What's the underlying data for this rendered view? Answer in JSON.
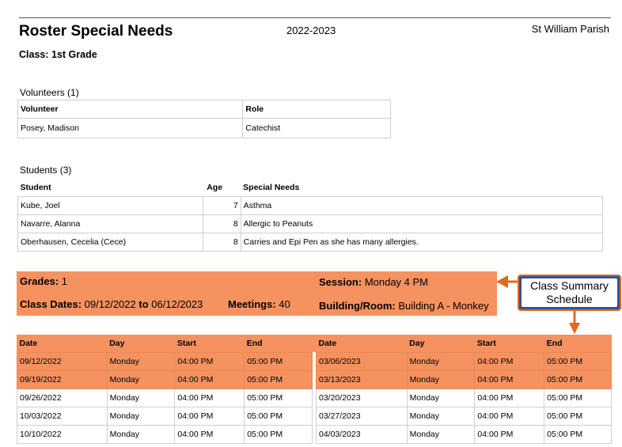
{
  "header": {
    "title": "Roster Special Needs",
    "year": "2022-2023",
    "parish": "St William Parish",
    "class_label": "Class: 1st Grade"
  },
  "volunteers": {
    "heading": "Volunteers (1)",
    "columns": [
      "Volunteer",
      "Role"
    ],
    "rows": [
      [
        "Posey, Madison",
        "Catechist"
      ]
    ]
  },
  "students": {
    "heading": "Students (3)",
    "columns": [
      "Student",
      "Age",
      "Special Needs"
    ],
    "rows": [
      [
        "Kube, Joel",
        "7",
        "Asthma"
      ],
      [
        "Navarre, Alanna",
        "8",
        "Allergic to Peanuts"
      ],
      [
        "Oberhausen, Cecelia (Cece)",
        "8",
        "Carries and Epi Pen as she has many allergies."
      ]
    ]
  },
  "summary": {
    "grades_label": "Grades:",
    "grades_value": "1",
    "session_label": "Session:",
    "session_value": "Monday 4 PM",
    "dates_label": "Class Dates:",
    "dates_start": "09/12/2022",
    "dates_to": "to",
    "dates_end": "06/12/2023",
    "meetings_label": "Meetings:",
    "meetings_value": "40",
    "room_label": "Building/Room:",
    "room_value": "Building A - Monkey"
  },
  "schedule": {
    "columns": [
      "Date",
      "Day",
      "Start",
      "End"
    ],
    "left": [
      [
        "09/12/2022",
        "Monday",
        "04:00 PM",
        "05:00 PM"
      ],
      [
        "09/19/2022",
        "Monday",
        "04:00 PM",
        "05:00 PM"
      ],
      [
        "09/26/2022",
        "Monday",
        "04:00 PM",
        "05:00 PM"
      ],
      [
        "10/03/2022",
        "Monday",
        "04:00 PM",
        "05:00 PM"
      ],
      [
        "10/10/2022",
        "Monday",
        "04:00 PM",
        "05:00 PM"
      ]
    ],
    "right": [
      [
        "03/06/2023",
        "Monday",
        "04:00 PM",
        "05:00 PM"
      ],
      [
        "03/13/2023",
        "Monday",
        "04:00 PM",
        "05:00 PM"
      ],
      [
        "03/20/2023",
        "Monday",
        "04:00 PM",
        "05:00 PM"
      ],
      [
        "03/27/2023",
        "Monday",
        "04:00 PM",
        "05:00 PM"
      ],
      [
        "04/03/2023",
        "Monday",
        "04:00 PM",
        "05:00 PM"
      ]
    ]
  },
  "callout": {
    "line1": "Class Summary",
    "line2": "Schedule"
  },
  "colors": {
    "highlight": "#f5925f",
    "callout_border": "#e2671f",
    "arrow": "#e2671f"
  }
}
